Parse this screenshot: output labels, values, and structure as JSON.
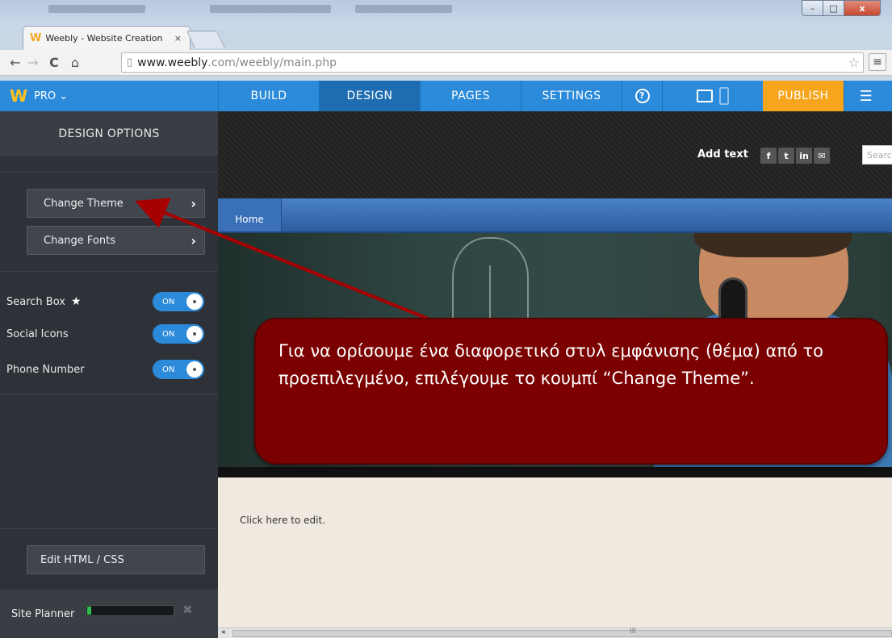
{
  "browser": {
    "tab_title": "Weebly - Website Creation",
    "tab_close": "×",
    "url_host": "www.weebly",
    "url_path": ".com/weebly/main.php",
    "window_buttons": {
      "minimize": "–",
      "maximize": "□",
      "close": "x"
    }
  },
  "weebly_bar": {
    "pro_label": "PRO ⌄",
    "nav": [
      "BUILD",
      "DESIGN",
      "PAGES",
      "SETTINGS"
    ],
    "help": "?",
    "publish": "PUBLISH",
    "menu": "☰",
    "active_tab": "DESIGN"
  },
  "sidebar": {
    "header": "DESIGN OPTIONS",
    "buttons": [
      "Change Theme",
      "Change Fonts"
    ],
    "toggles": [
      {
        "label": "Search Box",
        "state": "ON",
        "star": true
      },
      {
        "label": "Social Icons",
        "state": "ON"
      },
      {
        "label": "Phone Number",
        "state": "ON"
      }
    ],
    "edit_html": "Edit HTML / CSS",
    "site_planner": "Site Planner",
    "site_planner_progress": 0.05
  },
  "site": {
    "add_text": "Add text",
    "social": [
      "f",
      "t",
      "in",
      "✉"
    ],
    "search_placeholder": "Searc",
    "nav_home": "Home",
    "content_text": "Click here to edit.",
    "scroll_grip": "III"
  },
  "callout": {
    "text": "Για να ορίσουμε ένα διαφορετικό στυλ εμφάνισης (θέμα) από το προεπιλεγμένο, επιλέγουμε το κουμπί “Change Theme”."
  },
  "colors": {
    "weebly_blue": "#2b8ad9",
    "publish_orange": "#f7a51c",
    "sidebar_dark": "#2e3238",
    "callout_red": "#7b0000"
  }
}
